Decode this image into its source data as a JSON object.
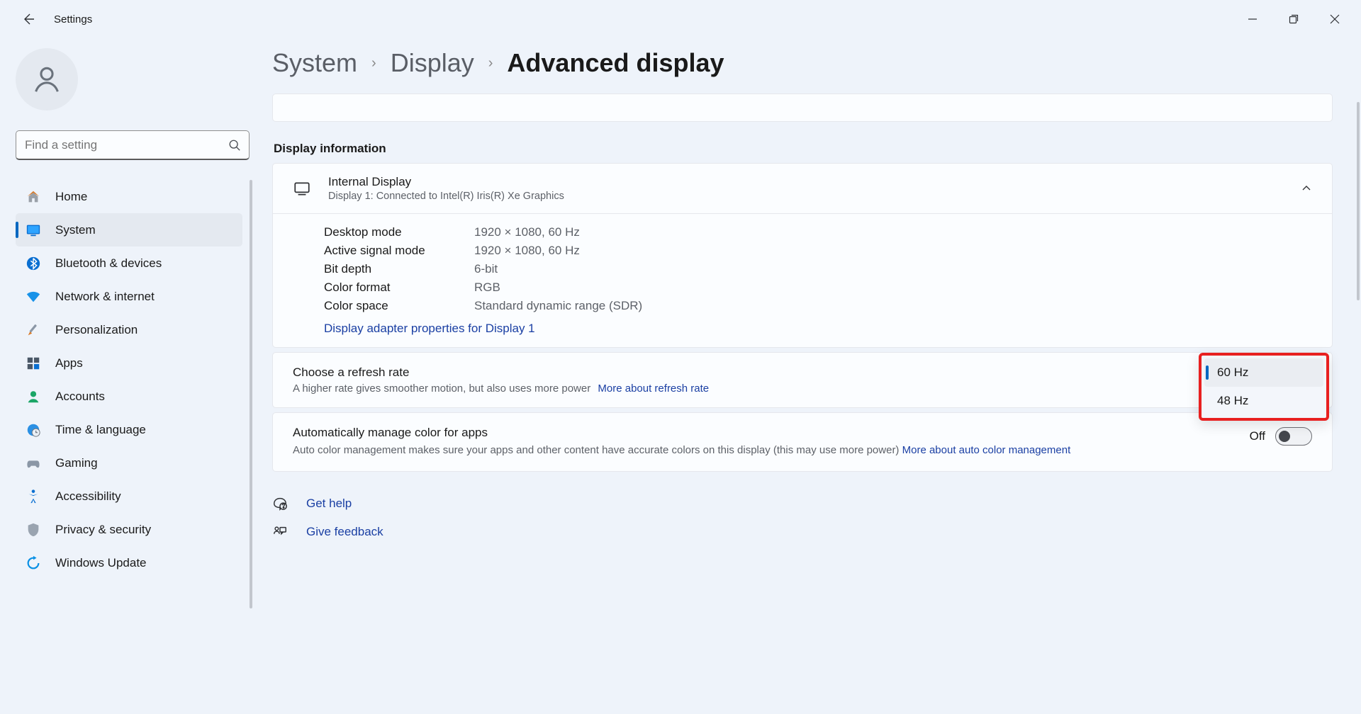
{
  "app_title": "Settings",
  "search_placeholder": "Find a setting",
  "nav": [
    {
      "label": "Home"
    },
    {
      "label": "System"
    },
    {
      "label": "Bluetooth & devices"
    },
    {
      "label": "Network & internet"
    },
    {
      "label": "Personalization"
    },
    {
      "label": "Apps"
    },
    {
      "label": "Accounts"
    },
    {
      "label": "Time & language"
    },
    {
      "label": "Gaming"
    },
    {
      "label": "Accessibility"
    },
    {
      "label": "Privacy & security"
    },
    {
      "label": "Windows Update"
    }
  ],
  "breadcrumb": {
    "system": "System",
    "display": "Display",
    "current": "Advanced display"
  },
  "section_heading": "Display information",
  "display_info": {
    "title": "Internal Display",
    "subtitle": "Display 1: Connected to Intel(R) Iris(R) Xe Graphics",
    "rows": [
      {
        "label": "Desktop mode",
        "value": "1920 × 1080, 60 Hz"
      },
      {
        "label": "Active signal mode",
        "value": "1920 × 1080, 60 Hz"
      },
      {
        "label": "Bit depth",
        "value": "6-bit"
      },
      {
        "label": "Color format",
        "value": "RGB"
      },
      {
        "label": "Color space",
        "value": "Standard dynamic range (SDR)"
      }
    ],
    "adapter_link": "Display adapter properties for Display 1"
  },
  "refresh": {
    "title": "Choose a refresh rate",
    "desc": "A higher rate gives smoother motion, but also uses more power",
    "more_link": "More about refresh rate",
    "options": [
      {
        "label": "60 Hz",
        "selected": true
      },
      {
        "label": "48 Hz",
        "selected": false
      }
    ]
  },
  "color_mgmt": {
    "title": "Automatically manage color for apps",
    "desc_pre": "Auto color management makes sure your apps and other content have accurate colors on this display (this may use more power) ",
    "more_link": "More about auto color management",
    "toggle_label": "Off"
  },
  "footer": {
    "help": "Get help",
    "feedback": "Give feedback"
  }
}
